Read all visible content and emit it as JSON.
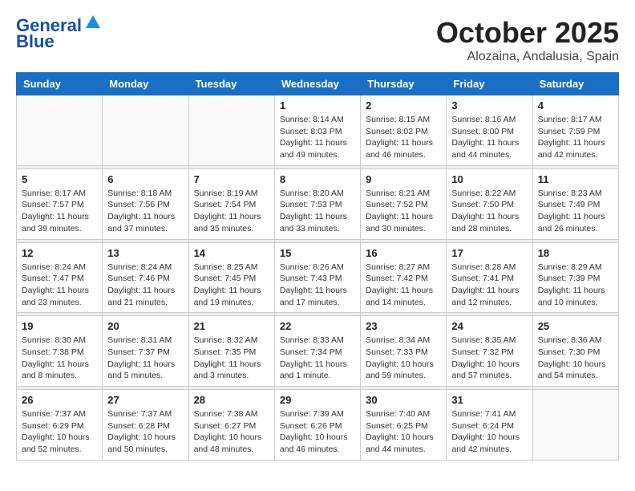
{
  "header": {
    "logo_line1": "General",
    "logo_line2": "Blue",
    "month": "October 2025",
    "location": "Alozaina, Andalusia, Spain"
  },
  "days_of_week": [
    "Sunday",
    "Monday",
    "Tuesday",
    "Wednesday",
    "Thursday",
    "Friday",
    "Saturday"
  ],
  "weeks": [
    [
      {
        "day": "",
        "sunrise": "",
        "sunset": "",
        "daylight": ""
      },
      {
        "day": "",
        "sunrise": "",
        "sunset": "",
        "daylight": ""
      },
      {
        "day": "",
        "sunrise": "",
        "sunset": "",
        "daylight": ""
      },
      {
        "day": "1",
        "sunrise": "Sunrise: 8:14 AM",
        "sunset": "Sunset: 8:03 PM",
        "daylight": "Daylight: 11 hours and 49 minutes."
      },
      {
        "day": "2",
        "sunrise": "Sunrise: 8:15 AM",
        "sunset": "Sunset: 8:02 PM",
        "daylight": "Daylight: 11 hours and 46 minutes."
      },
      {
        "day": "3",
        "sunrise": "Sunrise: 8:16 AM",
        "sunset": "Sunset: 8:00 PM",
        "daylight": "Daylight: 11 hours and 44 minutes."
      },
      {
        "day": "4",
        "sunrise": "Sunrise: 8:17 AM",
        "sunset": "Sunset: 7:59 PM",
        "daylight": "Daylight: 11 hours and 42 minutes."
      }
    ],
    [
      {
        "day": "5",
        "sunrise": "Sunrise: 8:17 AM",
        "sunset": "Sunset: 7:57 PM",
        "daylight": "Daylight: 11 hours and 39 minutes."
      },
      {
        "day": "6",
        "sunrise": "Sunrise: 8:18 AM",
        "sunset": "Sunset: 7:56 PM",
        "daylight": "Daylight: 11 hours and 37 minutes."
      },
      {
        "day": "7",
        "sunrise": "Sunrise: 8:19 AM",
        "sunset": "Sunset: 7:54 PM",
        "daylight": "Daylight: 11 hours and 35 minutes."
      },
      {
        "day": "8",
        "sunrise": "Sunrise: 8:20 AM",
        "sunset": "Sunset: 7:53 PM",
        "daylight": "Daylight: 11 hours and 33 minutes."
      },
      {
        "day": "9",
        "sunrise": "Sunrise: 8:21 AM",
        "sunset": "Sunset: 7:52 PM",
        "daylight": "Daylight: 11 hours and 30 minutes."
      },
      {
        "day": "10",
        "sunrise": "Sunrise: 8:22 AM",
        "sunset": "Sunset: 7:50 PM",
        "daylight": "Daylight: 11 hours and 28 minutes."
      },
      {
        "day": "11",
        "sunrise": "Sunrise: 8:23 AM",
        "sunset": "Sunset: 7:49 PM",
        "daylight": "Daylight: 11 hours and 26 minutes."
      }
    ],
    [
      {
        "day": "12",
        "sunrise": "Sunrise: 8:24 AM",
        "sunset": "Sunset: 7:47 PM",
        "daylight": "Daylight: 11 hours and 23 minutes."
      },
      {
        "day": "13",
        "sunrise": "Sunrise: 8:24 AM",
        "sunset": "Sunset: 7:46 PM",
        "daylight": "Daylight: 11 hours and 21 minutes."
      },
      {
        "day": "14",
        "sunrise": "Sunrise: 8:25 AM",
        "sunset": "Sunset: 7:45 PM",
        "daylight": "Daylight: 11 hours and 19 minutes."
      },
      {
        "day": "15",
        "sunrise": "Sunrise: 8:26 AM",
        "sunset": "Sunset: 7:43 PM",
        "daylight": "Daylight: 11 hours and 17 minutes."
      },
      {
        "day": "16",
        "sunrise": "Sunrise: 8:27 AM",
        "sunset": "Sunset: 7:42 PM",
        "daylight": "Daylight: 11 hours and 14 minutes."
      },
      {
        "day": "17",
        "sunrise": "Sunrise: 8:28 AM",
        "sunset": "Sunset: 7:41 PM",
        "daylight": "Daylight: 11 hours and 12 minutes."
      },
      {
        "day": "18",
        "sunrise": "Sunrise: 8:29 AM",
        "sunset": "Sunset: 7:39 PM",
        "daylight": "Daylight: 11 hours and 10 minutes."
      }
    ],
    [
      {
        "day": "19",
        "sunrise": "Sunrise: 8:30 AM",
        "sunset": "Sunset: 7:38 PM",
        "daylight": "Daylight: 11 hours and 8 minutes."
      },
      {
        "day": "20",
        "sunrise": "Sunrise: 8:31 AM",
        "sunset": "Sunset: 7:37 PM",
        "daylight": "Daylight: 11 hours and 5 minutes."
      },
      {
        "day": "21",
        "sunrise": "Sunrise: 8:32 AM",
        "sunset": "Sunset: 7:35 PM",
        "daylight": "Daylight: 11 hours and 3 minutes."
      },
      {
        "day": "22",
        "sunrise": "Sunrise: 8:33 AM",
        "sunset": "Sunset: 7:34 PM",
        "daylight": "Daylight: 11 hours and 1 minute."
      },
      {
        "day": "23",
        "sunrise": "Sunrise: 8:34 AM",
        "sunset": "Sunset: 7:33 PM",
        "daylight": "Daylight: 10 hours and 59 minutes."
      },
      {
        "day": "24",
        "sunrise": "Sunrise: 8:35 AM",
        "sunset": "Sunset: 7:32 PM",
        "daylight": "Daylight: 10 hours and 57 minutes."
      },
      {
        "day": "25",
        "sunrise": "Sunrise: 8:36 AM",
        "sunset": "Sunset: 7:30 PM",
        "daylight": "Daylight: 10 hours and 54 minutes."
      }
    ],
    [
      {
        "day": "26",
        "sunrise": "Sunrise: 7:37 AM",
        "sunset": "Sunset: 6:29 PM",
        "daylight": "Daylight: 10 hours and 52 minutes."
      },
      {
        "day": "27",
        "sunrise": "Sunrise: 7:37 AM",
        "sunset": "Sunset: 6:28 PM",
        "daylight": "Daylight: 10 hours and 50 minutes."
      },
      {
        "day": "28",
        "sunrise": "Sunrise: 7:38 AM",
        "sunset": "Sunset: 6:27 PM",
        "daylight": "Daylight: 10 hours and 48 minutes."
      },
      {
        "day": "29",
        "sunrise": "Sunrise: 7:39 AM",
        "sunset": "Sunset: 6:26 PM",
        "daylight": "Daylight: 10 hours and 46 minutes."
      },
      {
        "day": "30",
        "sunrise": "Sunrise: 7:40 AM",
        "sunset": "Sunset: 6:25 PM",
        "daylight": "Daylight: 10 hours and 44 minutes."
      },
      {
        "day": "31",
        "sunrise": "Sunrise: 7:41 AM",
        "sunset": "Sunset: 6:24 PM",
        "daylight": "Daylight: 10 hours and 42 minutes."
      },
      {
        "day": "",
        "sunrise": "",
        "sunset": "",
        "daylight": ""
      }
    ]
  ]
}
